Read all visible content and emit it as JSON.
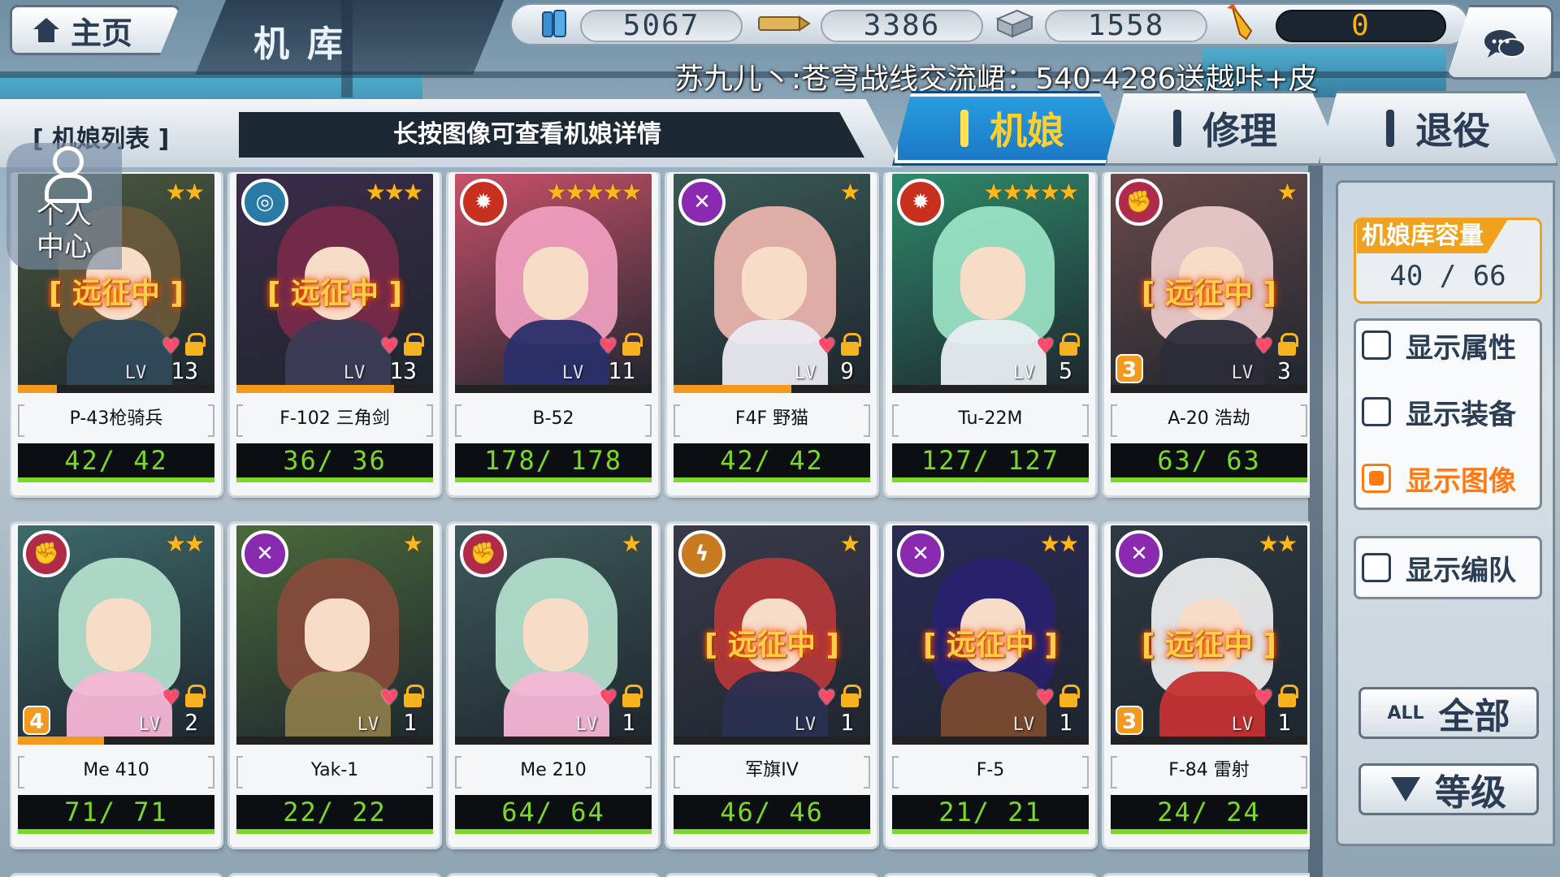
{
  "header": {
    "home_label": "主页",
    "page_title": "机库",
    "marquee": "苏九儿丶:苍穹战线交流峮：540-4286送越咔+皮"
  },
  "resources": {
    "fuel": "5067",
    "ammo": "3386",
    "steel": "1558",
    "special": "0"
  },
  "list": {
    "label": "[ 机娘列表 ]",
    "hint": "长按图像可查看机娘详情"
  },
  "tabs": [
    {
      "label": "机娘"
    },
    {
      "label": "修理"
    },
    {
      "label": "退役"
    }
  ],
  "avatar": {
    "label": "个人\n中心"
  },
  "cards": [
    {
      "name": "P-43枪骑兵",
      "hp": "42/ 42",
      "level": "13",
      "stars": "★★",
      "expedition": "[ 远征中 ]",
      "exp_fraction": 0.2
    },
    {
      "name": "F-102 三角剑",
      "hp": "36/ 36",
      "level": "13",
      "stars": "★★★",
      "expedition": "[ 远征中 ]",
      "exp_fraction": 0.8
    },
    {
      "name": "B-52",
      "hp": "178/ 178",
      "level": "11",
      "stars": "★★★★★",
      "expedition": "",
      "exp_fraction": 0.0
    },
    {
      "name": "F4F 野猫",
      "hp": "42/ 42",
      "level": "9",
      "stars": "★",
      "expedition": "",
      "exp_fraction": 0.6
    },
    {
      "name": "Tu-22M",
      "hp": "127/ 127",
      "level": "5",
      "stars": "★★★★★",
      "expedition": "",
      "exp_fraction": 0.0
    },
    {
      "name": "A-20 浩劫",
      "hp": "63/ 63",
      "level": "3",
      "stars": "★",
      "expedition": "[ 远征中 ]",
      "exp_fraction": 0.0,
      "rank": "3"
    },
    {
      "name": "Me 410",
      "hp": "71/ 71",
      "level": "2",
      "stars": "★★",
      "expedition": "",
      "exp_fraction": 0.44,
      "rank": "4"
    },
    {
      "name": "Yak-1",
      "hp": "22/ 22",
      "level": "1",
      "stars": "★",
      "expedition": "",
      "exp_fraction": 0.0
    },
    {
      "name": "Me 210",
      "hp": "64/ 64",
      "level": "1",
      "stars": "★",
      "expedition": "",
      "exp_fraction": 0.0
    },
    {
      "name": "军旗IV",
      "hp": "46/ 46",
      "level": "1",
      "stars": "★",
      "expedition": "[ 远征中 ]",
      "exp_fraction": 0.0
    },
    {
      "name": "F-5",
      "hp": "21/ 21",
      "level": "1",
      "stars": "★★",
      "expedition": "[ 远征中 ]",
      "exp_fraction": 0.0
    },
    {
      "name": "F-84 雷射",
      "hp": "24/ 24",
      "level": "1",
      "stars": "★★",
      "expedition": "[ 远征中 ]",
      "exp_fraction": 0.0,
      "rank": "3"
    }
  ],
  "right_panel": {
    "capacity_label": "机娘库容量",
    "capacity_value": "40 / 66",
    "options": [
      {
        "label": "显示属性",
        "checked": false
      },
      {
        "label": "显示装备",
        "checked": false
      },
      {
        "label": "显示图像",
        "checked": true
      },
      {
        "label": "显示编队",
        "checked": false
      }
    ],
    "filter_small": "ALL",
    "filter_label": "全部",
    "sort_label": "等级"
  },
  "lv_text": "LV",
  "colors": {
    "accent_blue": "#1a78c4",
    "accent_orange": "#f0a21e",
    "hp_green": "#7bd82a",
    "star_gold": "#ffb81c"
  }
}
